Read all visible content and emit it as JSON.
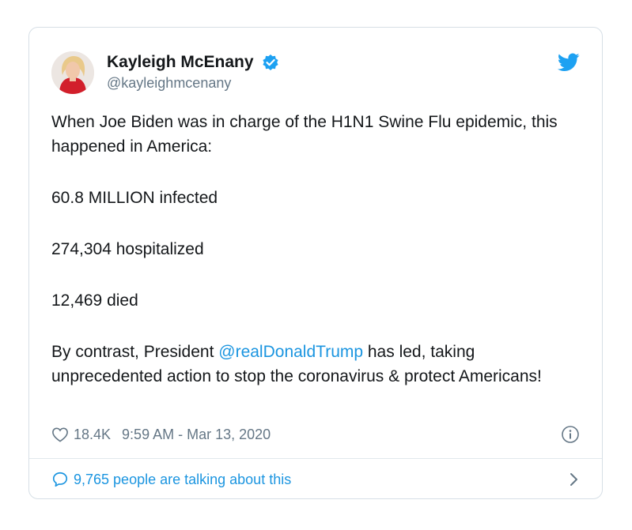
{
  "author": {
    "display_name": "Kayleigh McEnany",
    "handle": "@kayleighmcenany",
    "verified": true
  },
  "tweet": {
    "line1": "When Joe Biden was in charge of the H1N1 Swine Flu epidemic, this happened in America:",
    "infected": "60.8 MILLION infected",
    "hospitalized": "274,304 hospitalized",
    "died": "12,469 died",
    "contrast_before": "By contrast, President ",
    "mention": "@realDonaldTrump",
    "contrast_after": " has led, taking unprecedented action to stop the coronavirus & protect Americans!"
  },
  "meta": {
    "likes": "18.4K",
    "timestamp": "9:59 AM - Mar 13, 2020"
  },
  "footer": {
    "talking": "9,765 people are talking about this"
  },
  "icons": {
    "brand": "twitter-bird-icon",
    "verified": "verified-badge-icon",
    "like": "heart-icon",
    "info": "info-icon",
    "reply": "speech-bubble-icon",
    "more": "chevron-right-icon"
  },
  "colors": {
    "accent": "#1da1f2",
    "link": "#1b95e0",
    "text": "#14171a",
    "muted": "#657786"
  }
}
